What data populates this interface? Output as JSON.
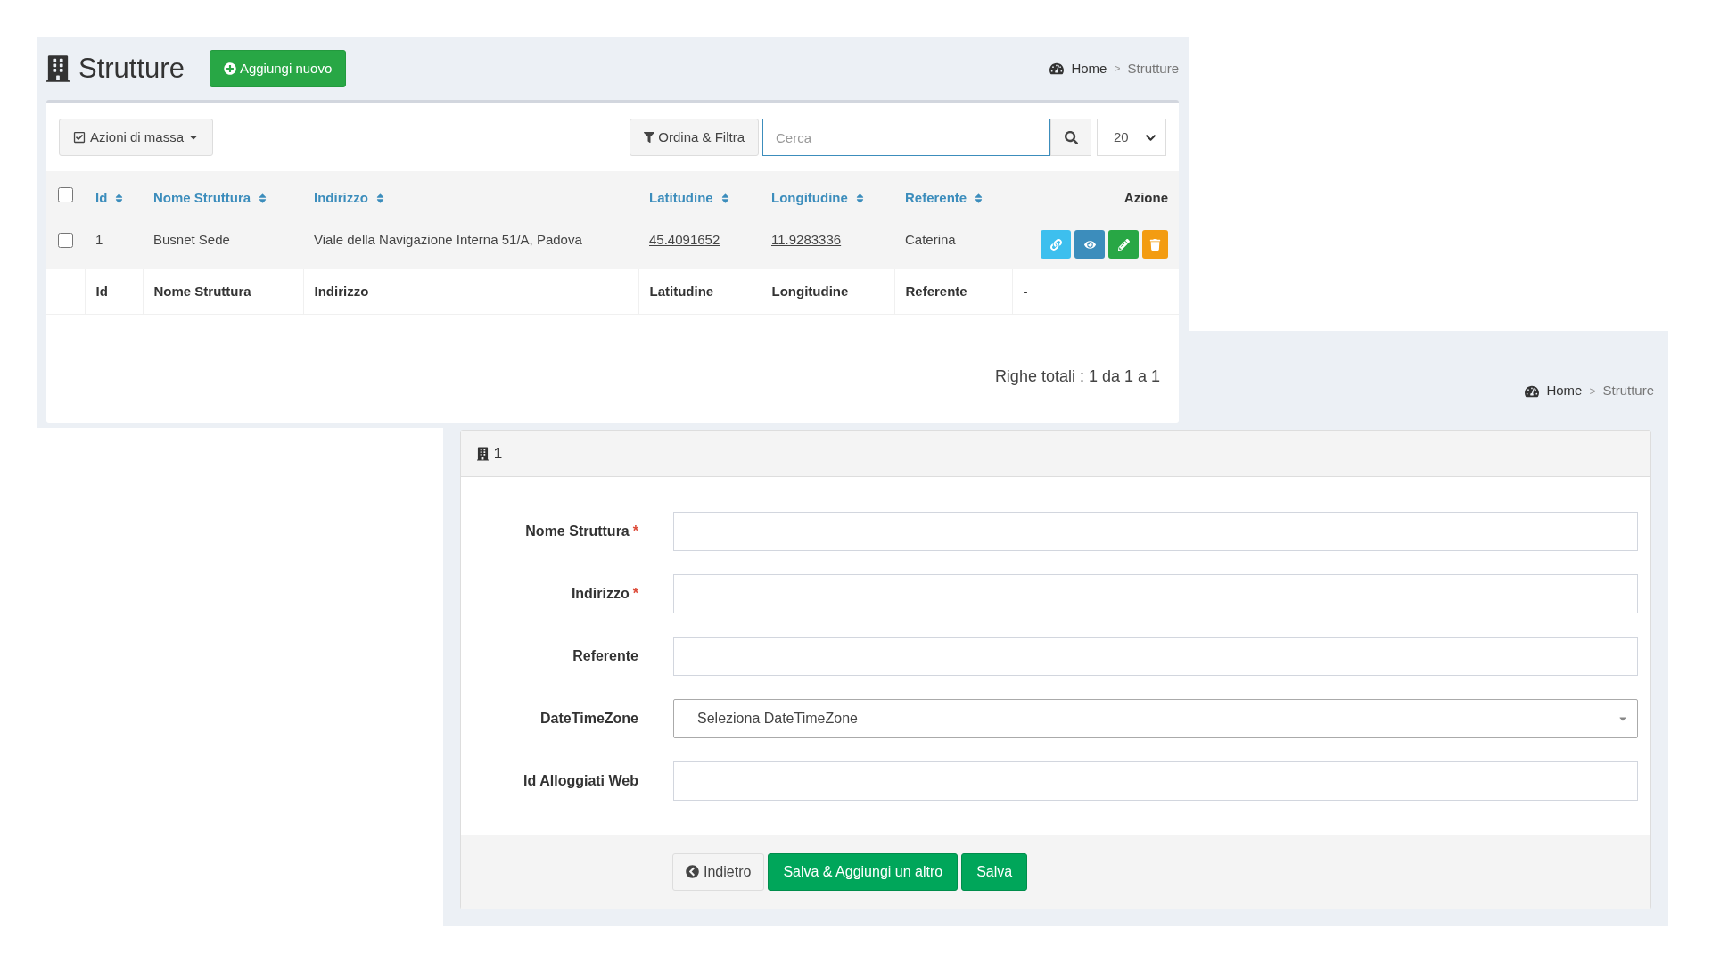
{
  "list_page": {
    "title": "Strutture",
    "add_button": "Aggiungi nuovo",
    "breadcrumb": [
      "Home",
      "Strutture"
    ],
    "breadcrumb_separator": ">",
    "bulk_actions": "Azioni di massa",
    "filter_button": "Ordina & Filtra",
    "search": {
      "placeholder": "Cerca"
    },
    "page_size": "20",
    "table": {
      "select_all": {
        "checked": false
      },
      "columns": [
        {
          "label": "Id",
          "sortable": true
        },
        {
          "label": "Nome Struttura",
          "sortable": true
        },
        {
          "label": "Indirizzo",
          "sortable": true
        },
        {
          "label": "Latitudine",
          "sortable": true
        },
        {
          "label": "Longitudine",
          "sortable": true
        },
        {
          "label": "Referente",
          "sortable": true
        },
        {
          "label": "Azione",
          "sortable": false
        }
      ],
      "rows": [
        {
          "checked": false,
          "cells": [
            "1",
            "Busnet Sede",
            "Viale della Navigazione Interna 51/A, Padova",
            "45.4091652",
            "11.9283336",
            "Caterina"
          ],
          "actions": [
            {
              "kind": "link",
              "color": "#3dbfee"
            },
            {
              "kind": "view",
              "color": "#3c8dbc"
            },
            {
              "kind": "edit",
              "color": "#28a745"
            },
            {
              "kind": "delete",
              "color": "#f39c12"
            }
          ]
        }
      ],
      "footer": [
        "Id",
        "Nome Struttura",
        "Indirizzo",
        "Latitudine",
        "Longitudine",
        "Referente",
        "-"
      ]
    },
    "total": "Righe totali : 1 da 1 a 1"
  },
  "edit_page": {
    "breadcrumb": [
      "Home",
      "Strutture"
    ],
    "breadcrumb_separator": ">",
    "panel_title": "1",
    "required_marker": "*",
    "fields": [
      {
        "label": "Nome Struttura",
        "required": true,
        "kind": "text"
      },
      {
        "label": "Indirizzo",
        "required": true,
        "kind": "text"
      },
      {
        "label": "Referente",
        "required": false,
        "kind": "text"
      },
      {
        "label": "DateTimeZone",
        "required": false,
        "kind": "select",
        "placeholder": "Seleziona DateTimeZone"
      },
      {
        "label": "Id Alloggiati Web",
        "required": false,
        "kind": "text"
      }
    ],
    "buttons": [
      {
        "label": "Indietro",
        "kind": "back"
      },
      {
        "label": "Salva & Aggiungi un altro",
        "kind": "primary"
      },
      {
        "label": "Salva",
        "kind": "primary"
      }
    ]
  }
}
